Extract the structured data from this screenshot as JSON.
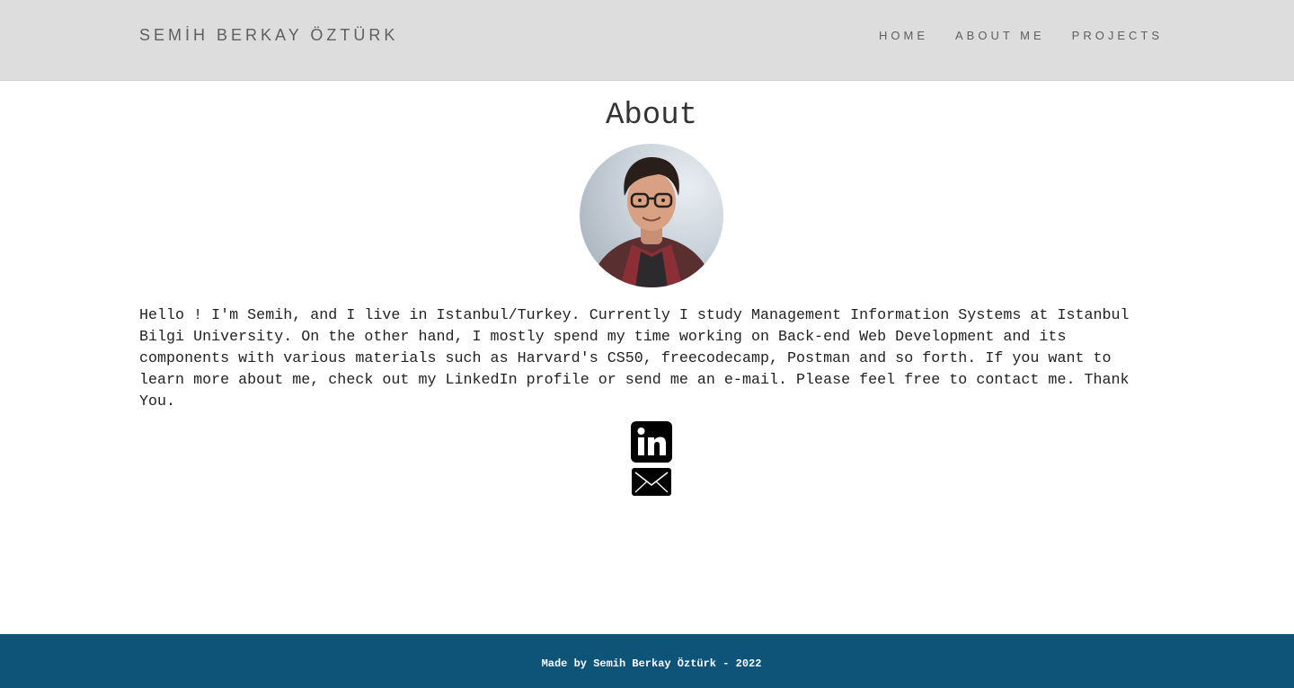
{
  "navbar": {
    "brand": "SEMİH BERKAY ÖZTÜRK",
    "links": [
      {
        "label": "HOME"
      },
      {
        "label": "ABOUT ME"
      },
      {
        "label": "PROJECTS"
      }
    ],
    "background": "#dddddd"
  },
  "main": {
    "title": "About",
    "avatar_icon": "profile-photo",
    "body": "Hello ! I'm Semih, and I live in Istanbul/Turkey. Currently I study Management Information Systems at Istanbul Bilgi University. On the other hand, I mostly spend my time working on Back-end Web Development and its components with various materials such as Harvard's CS50, freecodecamp, Postman and so forth. If you want to learn more about me, check out my LinkedIn profile or send me an e-mail. Please feel free to contact me. Thank You.",
    "social": [
      {
        "icon": "linkedin-icon"
      },
      {
        "icon": "mail-icon"
      }
    ]
  },
  "footer": {
    "text": "Made by Semih Berkay Öztürk - 2022",
    "background": "#0e5479"
  }
}
